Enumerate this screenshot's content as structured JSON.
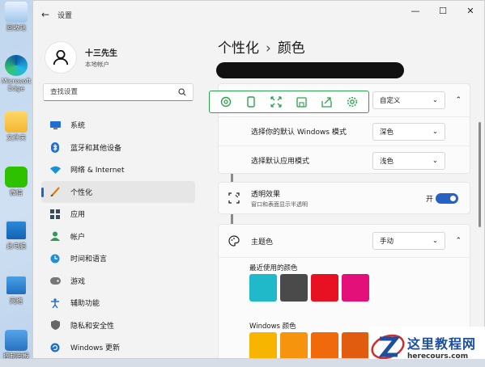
{
  "desktop": {
    "icons": [
      {
        "label": "回收站"
      },
      {
        "label": "Microsoft Edge"
      },
      {
        "label": "文件夹"
      },
      {
        "label": "微信"
      },
      {
        "label": "此电脑"
      },
      {
        "label": "网络"
      },
      {
        "label": "控制面板"
      }
    ]
  },
  "window": {
    "title": "设置",
    "back": "←",
    "minimize": "—",
    "maximize": "☐",
    "close": "✕"
  },
  "sidebar": {
    "user_name": "十三先生",
    "user_type": "本地帐户",
    "search_placeholder": "查找设置",
    "items": [
      {
        "label": "系统"
      },
      {
        "label": "蓝牙和其他设备"
      },
      {
        "label": "网络 & Internet"
      },
      {
        "label": "个性化",
        "active": true
      },
      {
        "label": "应用"
      },
      {
        "label": "帐户"
      },
      {
        "label": "时间和语言"
      },
      {
        "label": "游戏"
      },
      {
        "label": "辅助功能"
      },
      {
        "label": "隐私和安全性"
      },
      {
        "label": "Windows 更新"
      }
    ]
  },
  "content": {
    "breadcrumb_parent": "个性化",
    "breadcrumb_sep": "›",
    "breadcrumb_current": "颜色",
    "mode_dropdown": "自定义",
    "windows_mode_label": "选择你的默认 Windows 模式",
    "windows_mode_value": "深色",
    "app_mode_label": "选择默认应用模式",
    "app_mode_value": "浅色",
    "transparency_title": "透明效果",
    "transparency_desc": "窗口和表面显示半透明",
    "transparency_state": "开",
    "accent_title": "主题色",
    "accent_value": "手动",
    "recent_colors_label": "最近使用的颜色",
    "recent_colors": [
      "#1fb9c9",
      "#4a4a4a",
      "#e81123",
      "#e3107a"
    ],
    "windows_colors_label": "Windows 颜色",
    "windows_colors": [
      "#f7b500",
      "#f7940d",
      "#f06a0c",
      "#e25c10"
    ]
  },
  "watermark": {
    "title": "这里教程网",
    "url": "herecours.com"
  },
  "colors": {
    "accent": "#2661c4",
    "toolbar_green": "#2aa34a"
  }
}
